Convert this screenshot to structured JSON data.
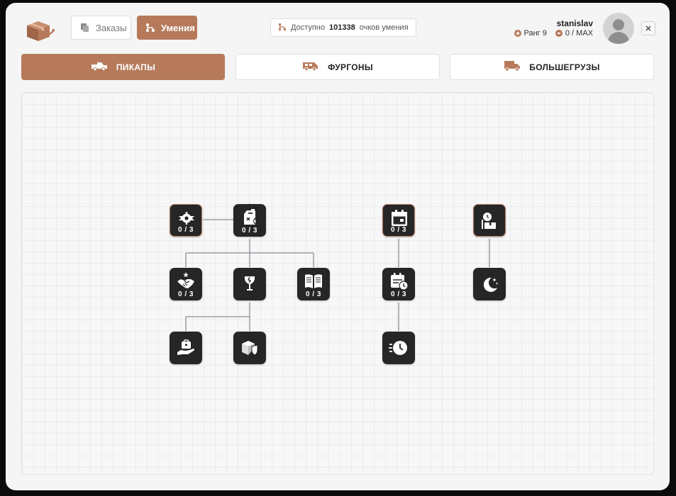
{
  "header": {
    "nav": {
      "orders_label": "Заказы",
      "skills_label": "Умения"
    },
    "points": {
      "prefix": "Доступно",
      "value": "101338",
      "suffix": "очков умения"
    },
    "user": {
      "name": "stanislav",
      "rank_label": "Ранг 9",
      "xp_label": "0 / MAX"
    }
  },
  "tabs": [
    {
      "label": "ПИКАПЫ",
      "icon": "pickup-truck-icon",
      "active": true
    },
    {
      "label": "ФУРГОНЫ",
      "icon": "van-icon",
      "active": false
    },
    {
      "label": "БОЛЬШЕГРУЗЫ",
      "icon": "lorry-icon",
      "active": false
    }
  ],
  "skills": [
    {
      "icon": "gear-wrench-icon",
      "counter": "0 / 3"
    },
    {
      "icon": "fuel-canister-icon",
      "counter": "0 / 3"
    },
    {
      "icon": "handshake-star-icon",
      "counter": "0 / 3"
    },
    {
      "icon": "fragile-glass-icon",
      "counter": ""
    },
    {
      "icon": "open-book-icon",
      "counter": "0 / 3"
    },
    {
      "icon": "hand-briefcase-icon",
      "counter": ""
    },
    {
      "icon": "package-shield-icon",
      "counter": ""
    },
    {
      "icon": "calendar-icon",
      "counter": "0 / 3"
    },
    {
      "icon": "calendar-clock-icon",
      "counter": "0 / 3"
    },
    {
      "icon": "fast-clock-icon",
      "counter": ""
    },
    {
      "icon": "timer-box-icon",
      "counter": ""
    },
    {
      "icon": "moon-stars-icon",
      "counter": ""
    }
  ],
  "colors": {
    "accent": "#b67a5b",
    "node_bg": "#262626",
    "link": "#8a8f99"
  }
}
